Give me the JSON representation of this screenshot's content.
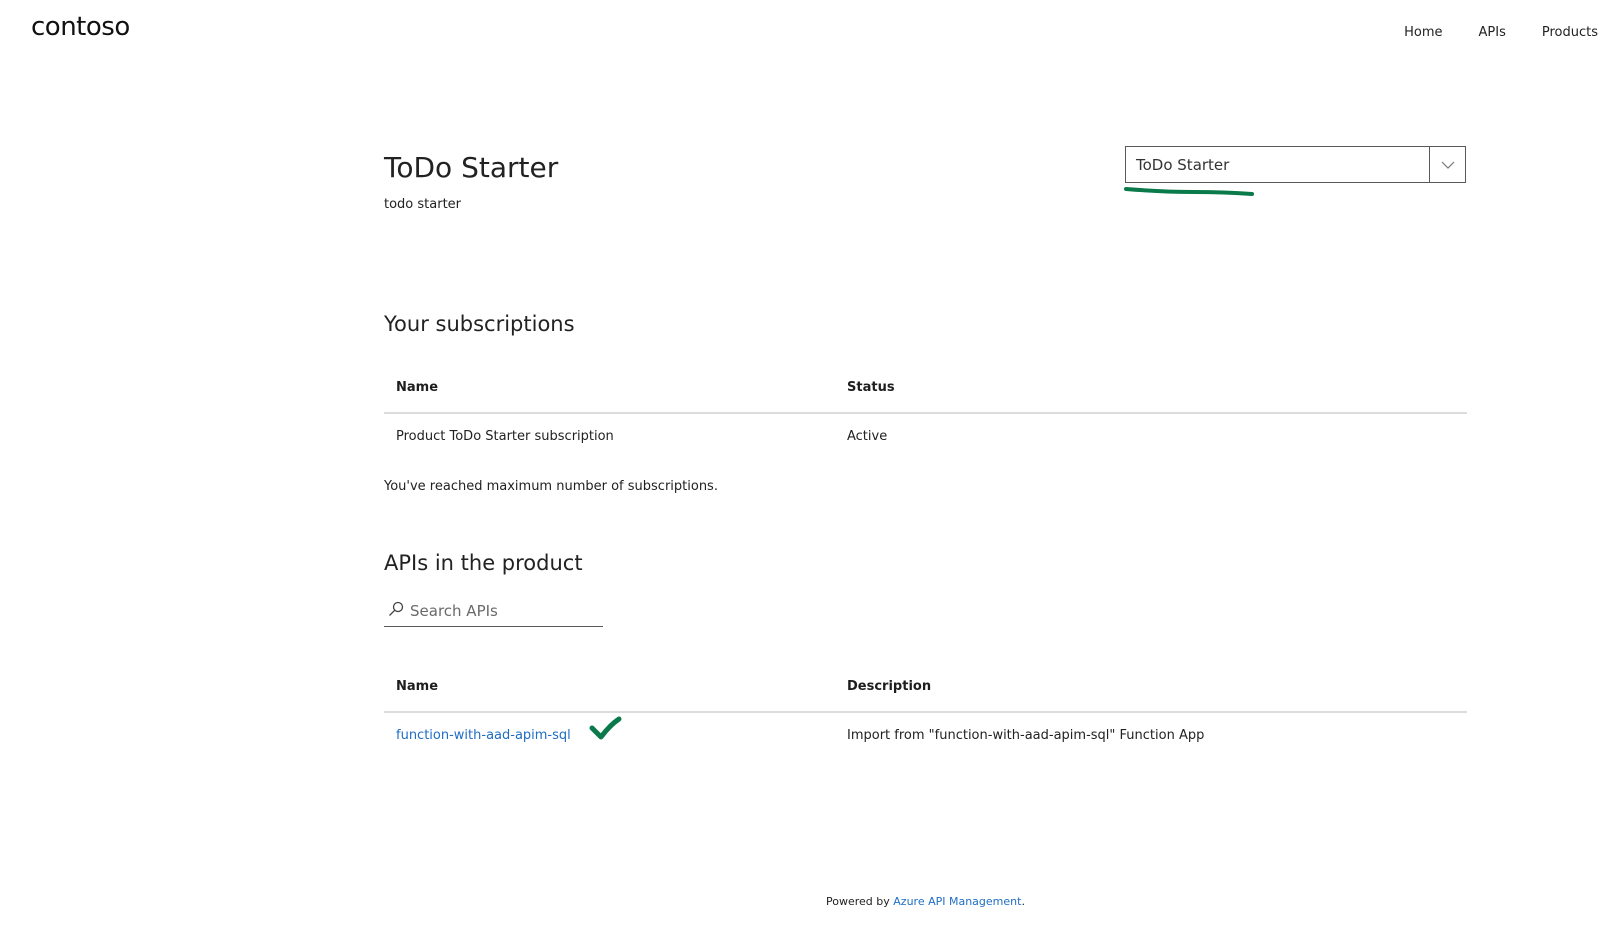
{
  "header": {
    "logo": "contoso",
    "nav": [
      "Home",
      "APIs",
      "Products"
    ]
  },
  "product": {
    "title": "ToDo Starter",
    "description": "todo starter",
    "selector_value": "ToDo Starter"
  },
  "subscriptions": {
    "heading": "Your subscriptions",
    "columns": [
      "Name",
      "Status"
    ],
    "rows": [
      {
        "name": "Product ToDo Starter subscription",
        "status": "Active"
      }
    ],
    "note": "You've reached maximum number of subscriptions."
  },
  "apis": {
    "heading": "APIs in the product",
    "search_placeholder": "Search APIs",
    "columns": [
      "Name",
      "Description"
    ],
    "rows": [
      {
        "name": "function-with-aad-apim-sql",
        "description": "Import from \"function-with-aad-apim-sql\" Function App"
      }
    ]
  },
  "footer": {
    "prefix": "Powered by ",
    "link": "Azure API Management",
    "suffix": "."
  },
  "colors": {
    "link": "#1f6dc4",
    "annotation": "#0b7a4b"
  }
}
